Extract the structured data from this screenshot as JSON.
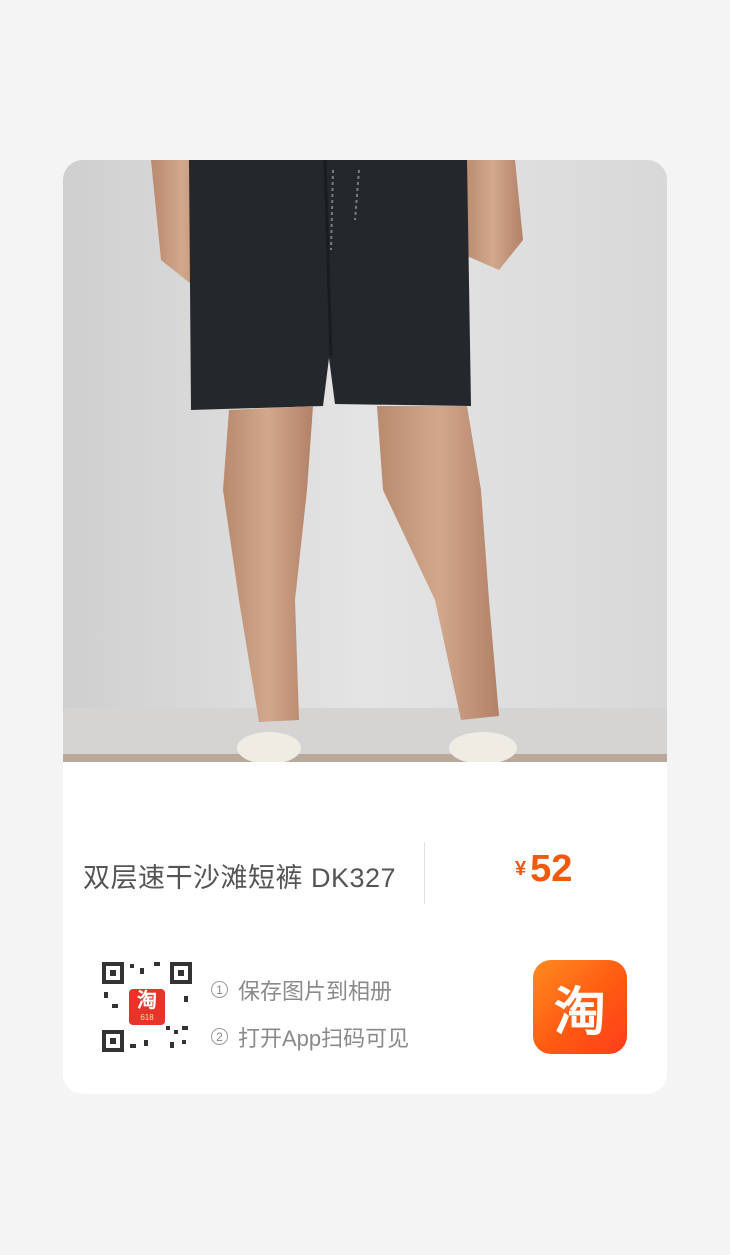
{
  "product": {
    "title": "双层速干沙滩短裤 DK327",
    "currency": "¥",
    "price": "52"
  },
  "qr": {
    "badge_char": "淘",
    "badge_sub": "618"
  },
  "steps": [
    {
      "num": "1",
      "text": "保存图片到相册"
    },
    {
      "num": "2",
      "text": "打开App扫码可见"
    }
  ],
  "app": {
    "logo_char": "淘"
  },
  "colors": {
    "price": "#f15a0c",
    "logo": "#ff5a12"
  },
  "icons": [
    "qr-code-icon",
    "taobao-logo-icon"
  ]
}
